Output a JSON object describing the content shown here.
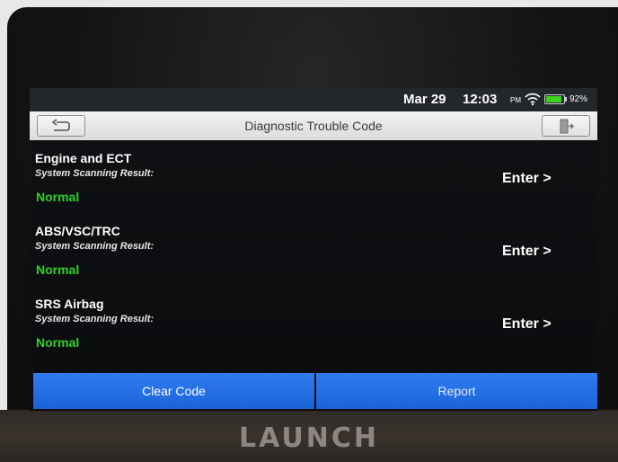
{
  "status_bar": {
    "date": "Mar 29",
    "time": "12:03",
    "ampm": "PM",
    "battery_percent": "92%",
    "battery_level": 0.92,
    "wifi_icon": "wifi-icon",
    "battery_icon": "battery-icon"
  },
  "header": {
    "title": "Diagnostic Trouble Code",
    "back_icon": "back-arrow-icon",
    "exit_icon": "exit-door-icon"
  },
  "systems": [
    {
      "name": "Engine and ECT",
      "scan_label": "System Scanning Result:",
      "result": "Normal",
      "enter_label": "Enter >"
    },
    {
      "name": "ABS/VSC/TRC",
      "scan_label": "System Scanning Result:",
      "result": "Normal",
      "enter_label": "Enter >"
    },
    {
      "name": "SRS Airbag",
      "scan_label": "System Scanning Result:",
      "result": "Normal",
      "enter_label": "Enter >"
    }
  ],
  "actions": {
    "clear_label": "Clear Code",
    "report_label": "Report"
  },
  "device": {
    "brand": "LAUNCH"
  },
  "colors": {
    "accent_blue": "#2f7cf0",
    "normal_green": "#2ed12a",
    "battery_green": "#3dd21e"
  }
}
